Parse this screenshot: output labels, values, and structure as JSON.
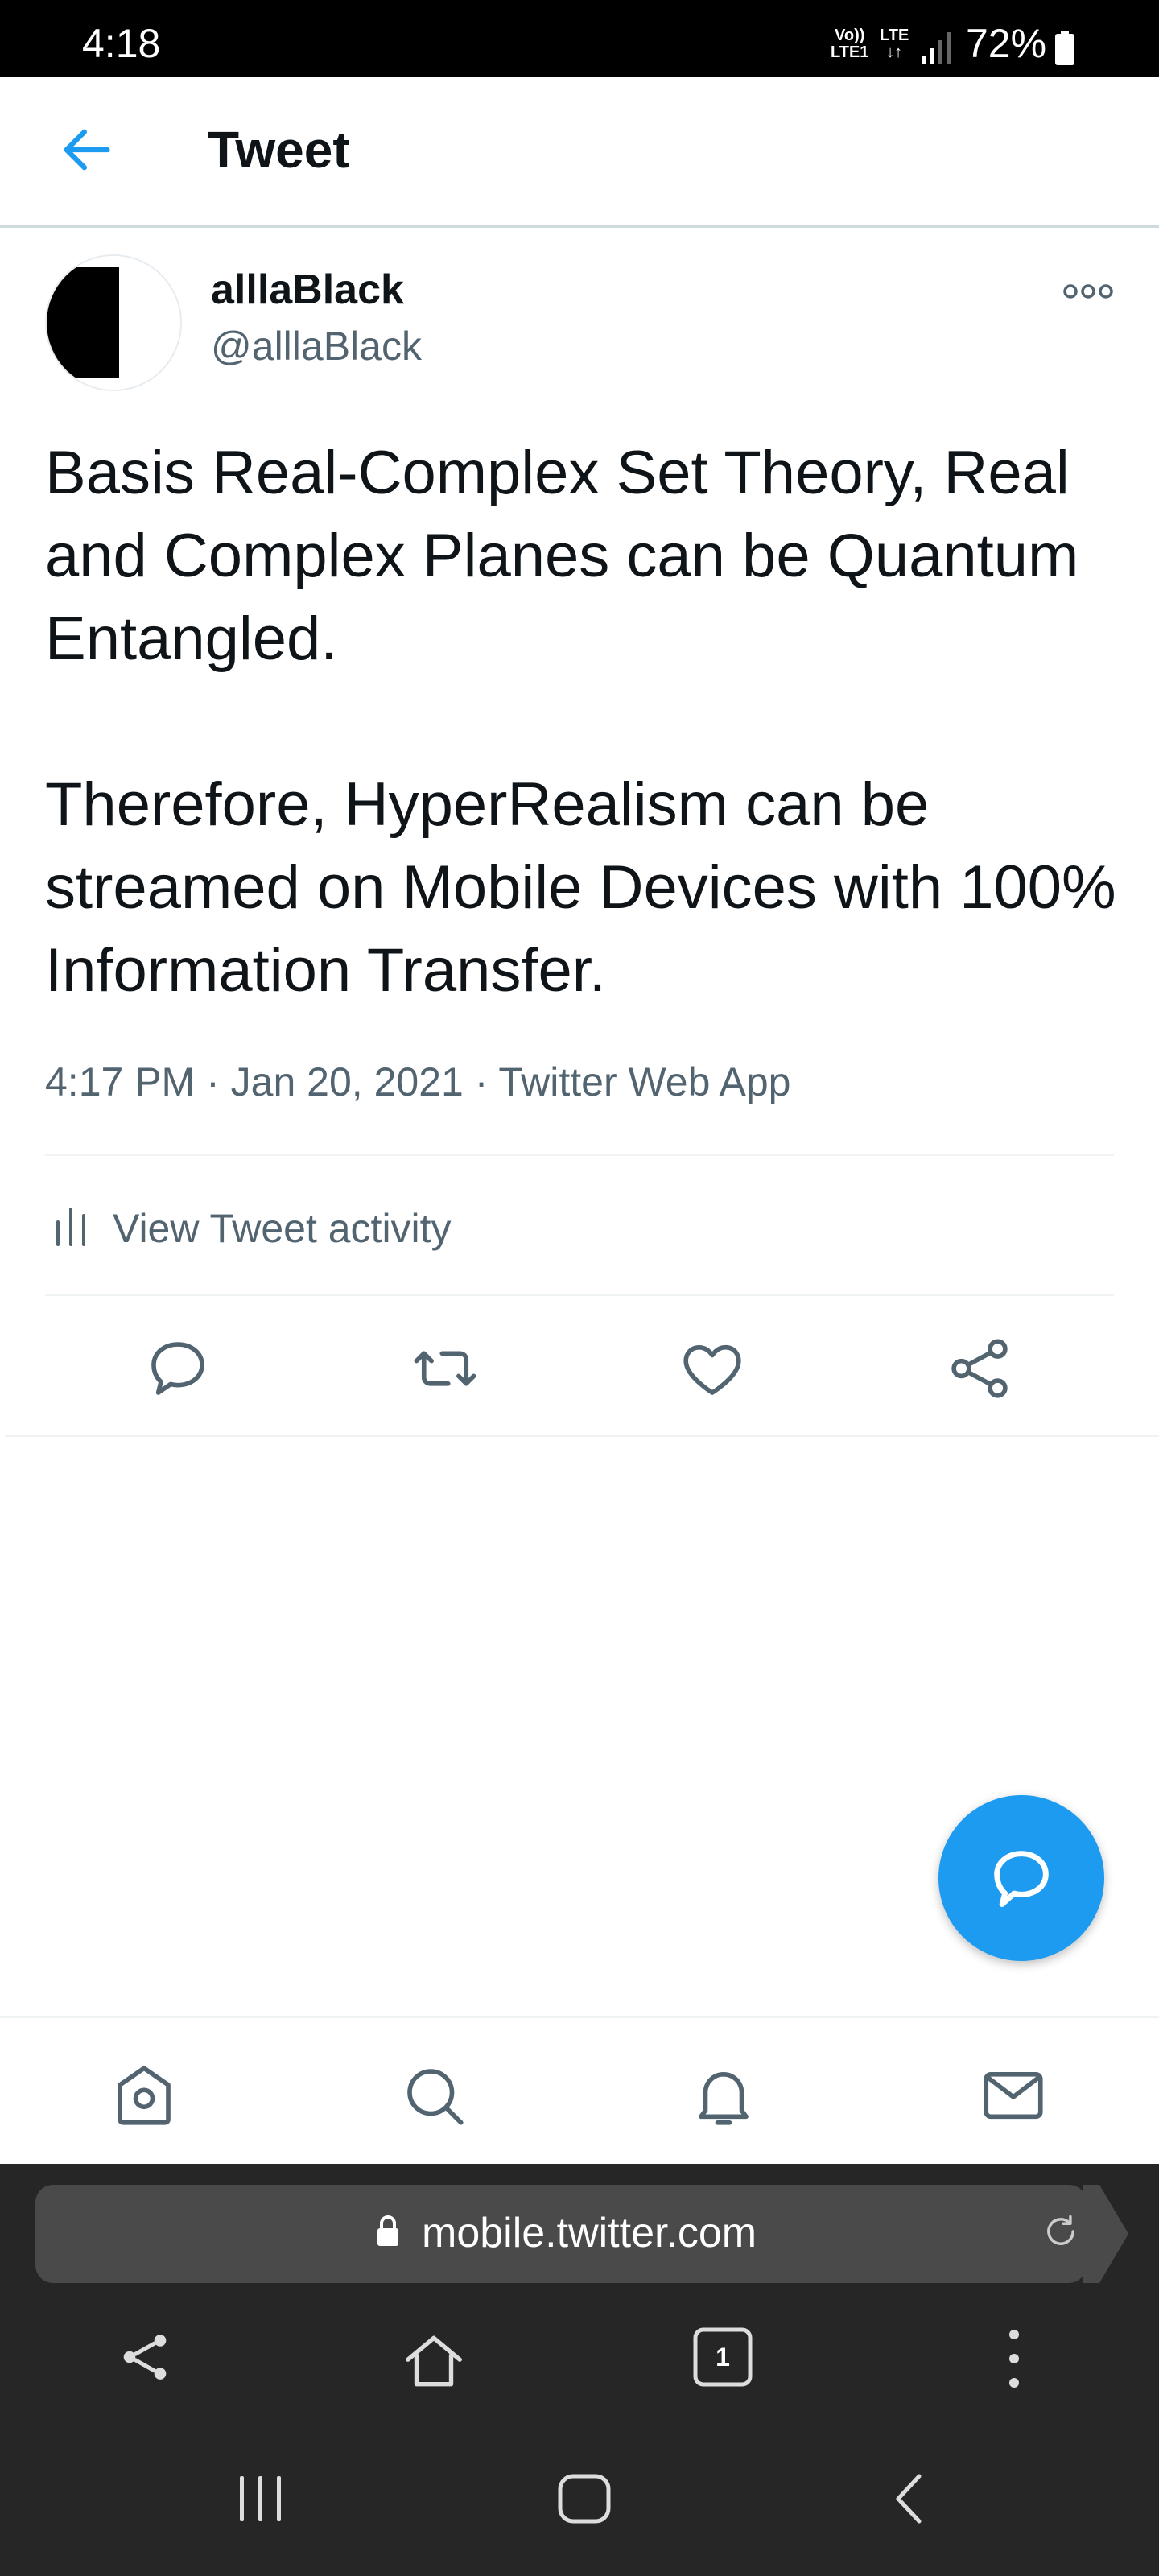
{
  "status_bar": {
    "time": "4:18",
    "volte_line1": "Vo))",
    "volte_line2": "LTE1",
    "lte_label": "LTE",
    "battery_percent": "72%"
  },
  "header": {
    "title": "Tweet",
    "back_icon": "arrow-left-icon"
  },
  "tweet": {
    "author_name": "alllaBlack",
    "author_handle": "@alllaBlack",
    "text": "Basis Real-Complex Set Theory, Real and Complex Planes can be Quantum Entangled.\n\nTherefore, HyperRealism can be streamed on Mobile Devices with 100% Information Transfer.",
    "time": "4:17 PM",
    "date": "Jan 20, 2021",
    "source": "Twitter Web App",
    "activity_label": "View Tweet activity"
  },
  "actions": [
    "reply-icon",
    "retweet-icon",
    "like-icon",
    "share-icon"
  ],
  "bottom_tabs": [
    "home-icon",
    "search-icon",
    "notifications-icon",
    "messages-icon"
  ],
  "browser": {
    "url": "mobile.twitter.com",
    "tab_count": "1"
  },
  "colors": {
    "accent": "#1d9bf0",
    "secondary_text": "#536471",
    "browser_bg": "#262626"
  }
}
